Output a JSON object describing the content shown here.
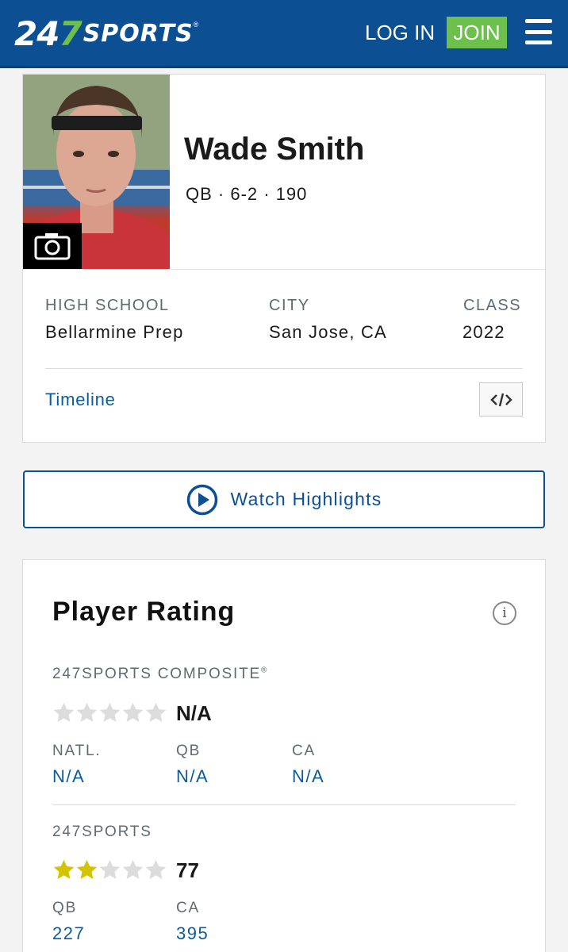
{
  "header": {
    "logo_num_a": "24",
    "logo_num_b": "7",
    "logo_word": "SPORTS",
    "logo_reg": "®",
    "login_label": "LOG IN",
    "join_label": "JOIN",
    "brand_color": "#0c4f93",
    "accent_color": "#6dc04b"
  },
  "profile": {
    "name": "Wade Smith",
    "bio": "QB · 6-2 · 190",
    "high_school_label": "HIGH SCHOOL",
    "high_school": "Bellarmine Prep",
    "city_label": "CITY",
    "city": "San Jose, CA",
    "class_label": "CLASS",
    "class": "2022",
    "timeline_label": "Timeline",
    "embed_icon_text": "</>"
  },
  "highlights": {
    "label": "Watch Highlights"
  },
  "rating": {
    "title": "Player Rating",
    "info_icon_text": "i",
    "composite": {
      "label": "247SPORTS COMPOSITE",
      "reg": "®",
      "stars_filled": 0,
      "stars_total": 5,
      "score": "N/A",
      "ranks": [
        {
          "label": "NATL.",
          "value": "N/A"
        },
        {
          "label": "QB",
          "value": "N/A"
        },
        {
          "label": "CA",
          "value": "N/A"
        }
      ]
    },
    "sports247": {
      "label": "247SPORTS",
      "stars_filled": 2,
      "stars_total": 5,
      "score": "77",
      "ranks": [
        {
          "label": "QB",
          "value": "227"
        },
        {
          "label": "CA",
          "value": "395"
        }
      ]
    },
    "star_on_color": "#d4c300",
    "star_off_color": "#dcdcdc"
  }
}
